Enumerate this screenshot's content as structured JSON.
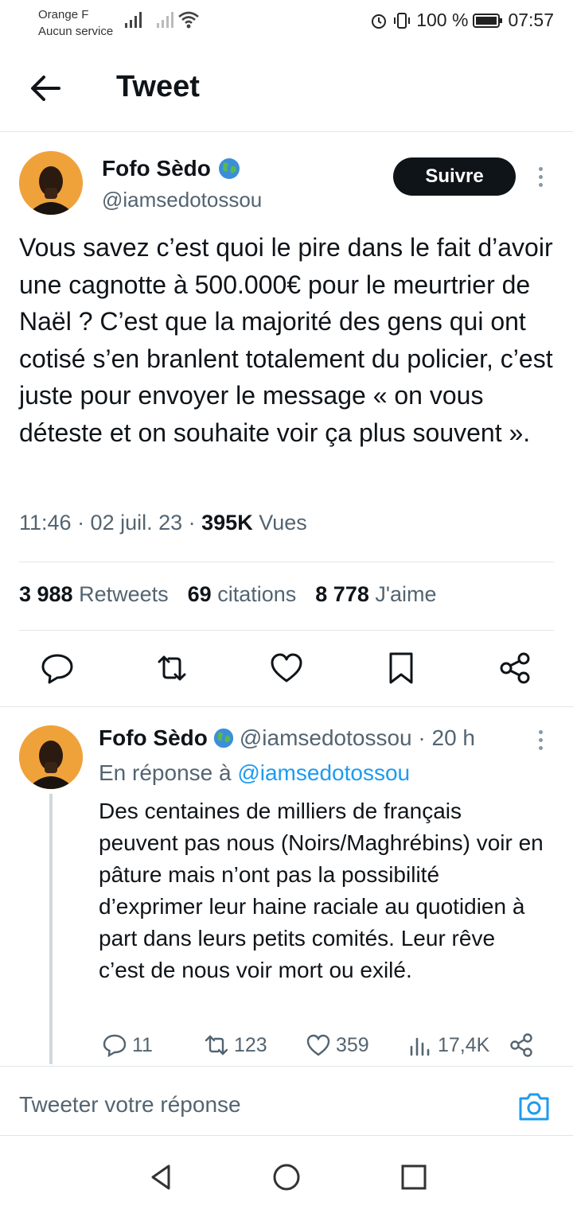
{
  "status_bar": {
    "carrier": "Orange F",
    "service": "Aucun service",
    "battery": "100 %",
    "time": "07:57"
  },
  "header": {
    "title": "Tweet"
  },
  "tweet": {
    "author_name": "Fofo Sèdo",
    "author_handle": "@iamsedotossou",
    "follow_label": "Suivre",
    "text": "Vous savez c’est quoi le pire dans le fait d’avoir une cagnotte à 500.000€ pour le meurtrier de Naël ? C’est que la majorité des gens qui ont cotisé s’en branlent totalement du policier, c’est juste pour envoyer le message « on vous déteste et on souhaite voir ça plus souvent ».",
    "time": "11:46 · 02 juil. 23 · ",
    "views_count": "395K",
    "views_label": " Vues",
    "stats": {
      "retweets_count": "3 988",
      "retweets_label": "Retweets",
      "quotes_count": "69",
      "quotes_label": "citations",
      "likes_count": "8 778",
      "likes_label": "J'aime"
    }
  },
  "reply": {
    "author_name": "Fofo Sèdo",
    "author_handle": "@iamsedotossou · 20 h",
    "reply_to_label": "En réponse à ",
    "reply_to_handle": "@iamsedotossou",
    "text": "Des centaines de milliers de français peuvent pas nous (Noirs/Maghrébins) voir en pâture mais n’ont pas la possibilité d’exprimer leur haine raciale au quotidien à part dans leurs petits comités. Leur rêve c’est de nous voir mort ou exilé.",
    "replies": "11",
    "retweets": "123",
    "likes": "359",
    "views": "17,4K"
  },
  "compose": {
    "placeholder": "Tweeter votre réponse"
  },
  "colors": {
    "accent": "#1d9bf0",
    "text": "#0f1419",
    "muted": "#536471",
    "avatar_bg": "#f0a23a"
  }
}
